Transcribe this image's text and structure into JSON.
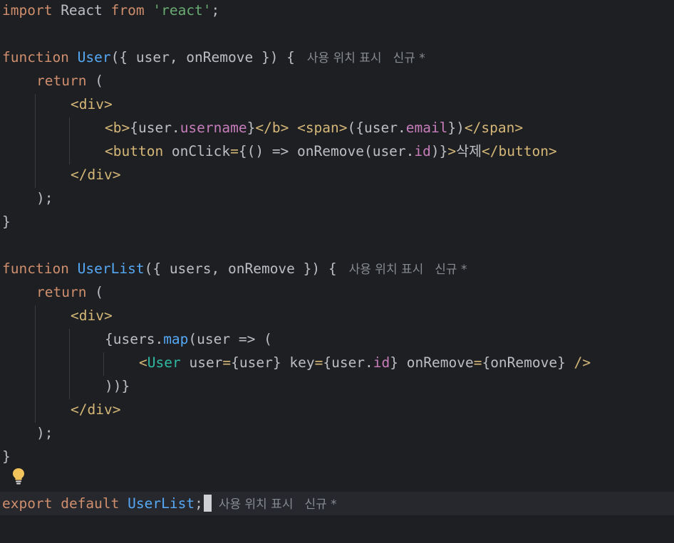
{
  "lines": {
    "l1": {
      "kw1": "import",
      "t1": " React ",
      "kw2": "from",
      "t2": " ",
      "str": "'react'",
      "t3": ";"
    },
    "l3": {
      "kw": "function",
      "t1": " ",
      "fn": "User",
      "t2": "({ user, onRemove }) {"
    },
    "l4": {
      "kw": "return",
      "t1": " ("
    },
    "l5": {
      "tag": "<div>"
    },
    "l6": {
      "tag1": "<b>",
      "t1": "{user.",
      "prop1": "username",
      "t2": "}",
      "tag2": "</b>",
      "t3": " ",
      "tag3": "<span>",
      "t4": "({user.",
      "prop2": "email",
      "t5": "})",
      "tag4": "</span>"
    },
    "l7": {
      "tag1": "<button ",
      "attr": "onClick",
      "op": "=",
      "t1": "{() => onRemove(user.",
      "prop": "id",
      "t2": ")}",
      "tag2": ">",
      "text": "삭제",
      "tag3": "</button>"
    },
    "l8": {
      "tag": "</div>"
    },
    "l9": {
      "t": ");"
    },
    "l10": {
      "t": "}"
    },
    "l12": {
      "kw": "function",
      "t1": " ",
      "fn": "UserList",
      "t2": "({ users, onRemove }) {"
    },
    "l13": {
      "kw": "return",
      "t1": " ("
    },
    "l14": {
      "tag": "<div>"
    },
    "l15": {
      "t1": "{users.",
      "fn": "map",
      "t2": "(user => ("
    },
    "l16": {
      "lt": "<",
      "comp": "User",
      "a1": " user",
      "op1": "=",
      "v1": "{user}",
      "a2": " key",
      "op2": "=",
      "v2a": "{user.",
      "prop": "id",
      "v2b": "}",
      "a3": " onRemove",
      "op3": "=",
      "v3": "{onRemove}",
      "close": " />"
    },
    "l17": {
      "t": "))}"
    },
    "l18": {
      "tag": "</div>"
    },
    "l19": {
      "t": ");"
    },
    "l20": {
      "t": "}"
    },
    "l22": {
      "kw1": "export",
      "t1": " ",
      "kw2": "default",
      "t2": " ",
      "fn": "UserList",
      "t3": ";"
    }
  },
  "hints": {
    "usages": "사용 위치 표시",
    "author": "신규 *"
  },
  "colors": {
    "background": "#1e1f22",
    "keyword": "#cf8e6d",
    "function": "#56a8f5",
    "string": "#6aab73",
    "tag": "#d5b778",
    "component": "#2fbaa3",
    "property": "#c77dbb",
    "hint": "#868a91"
  },
  "icons": {
    "gutter": "lightbulb-icon"
  }
}
